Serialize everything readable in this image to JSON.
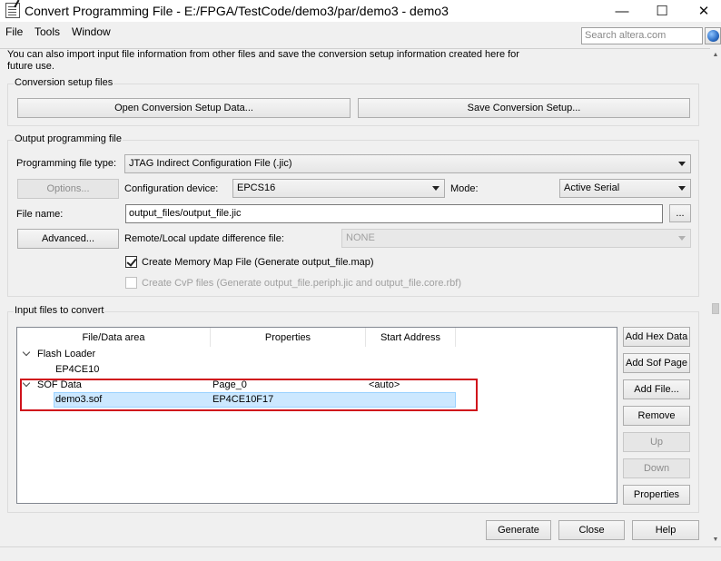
{
  "window": {
    "title": "Convert Programming File - E:/FPGA/TestCode/demo3/par/demo3 - demo3",
    "minimize_glyph": "—",
    "maximize_glyph": "☐",
    "close_glyph": "✕"
  },
  "menu": {
    "items": [
      "File",
      "Tools",
      "Window"
    ],
    "search_placeholder": "Search altera.com"
  },
  "intro_text": "You can also import input file information from other files and save the conversion setup information created here for future use.",
  "conversion_setup": {
    "group_label": "Conversion setup files",
    "open_button": "Open Conversion Setup Data...",
    "save_button": "Save Conversion Setup..."
  },
  "output": {
    "group_label": "Output programming file",
    "file_type_label": "Programming file type:",
    "file_type_value": "JTAG Indirect Configuration File (.jic)",
    "options_button": "Options...",
    "config_device_label": "Configuration device:",
    "config_device_value": "EPCS16",
    "mode_label": "Mode:",
    "mode_value": "Active Serial",
    "file_name_label": "File name:",
    "file_name_value": "output_files/output_file.jic",
    "browse_button": "...",
    "advanced_button": "Advanced...",
    "remote_label": "Remote/Local update difference file:",
    "remote_value": "NONE",
    "memory_map_label": "Create Memory Map File (Generate output_file.map)",
    "memory_map_checked": true,
    "cvp_label": "Create CvP files (Generate output_file.periph.jic and output_file.core.rbf)",
    "cvp_checked": false
  },
  "input": {
    "group_label": "Input files to convert",
    "columns": [
      "File/Data area",
      "Properties",
      "Start Address"
    ],
    "rows": [
      {
        "name": "Flash Loader",
        "properties": "",
        "start": ""
      },
      {
        "name": "EP4CE10",
        "properties": "",
        "start": ""
      },
      {
        "name": "SOF Data",
        "properties": "Page_0",
        "start": "<auto>"
      },
      {
        "name": "demo3.sof",
        "properties": "EP4CE10F17",
        "start": ""
      }
    ],
    "side_buttons": [
      "Add Hex Data",
      "Add Sof Page",
      "Add File...",
      "Remove",
      "Up",
      "Down",
      "Properties"
    ]
  },
  "footer": {
    "generate": "Generate",
    "close": "Close",
    "help": "Help"
  },
  "colors": {
    "selection": "#cce8ff",
    "highlight_border": "#d0121b"
  }
}
